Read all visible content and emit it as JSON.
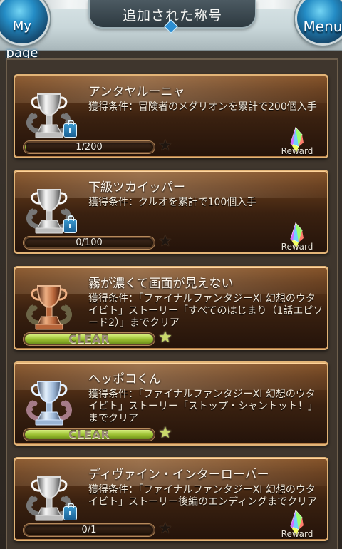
{
  "header": {
    "title": "追加された称号",
    "mypage_label_1": "My",
    "mypage_label_2": "page",
    "menu_label": "Menu"
  },
  "colors": {
    "gold_frame": "#e2b477",
    "card_brown": "#62391a",
    "progress_green": "#99bd2f",
    "blue_lock": "#1a5f93"
  },
  "titles": [
    {
      "name": "アンタヤルーニャ",
      "description": "獲得条件：冒険者のメダリオンを累計で200個入手",
      "progress_text": "1/200",
      "progress_ratio": 0.005,
      "state": "locked",
      "trophy": "silver-trophy",
      "show_reward": true,
      "reward_label": "Reward"
    },
    {
      "name": "下級ツカイッパー",
      "description": "獲得条件：クルオを累計で100個入手",
      "progress_text": "0/100",
      "progress_ratio": 0,
      "state": "locked",
      "trophy": "silver-trophy",
      "show_reward": true,
      "reward_label": "Reward"
    },
    {
      "name": "霧が濃くて画面が見えない",
      "description": "獲得条件：「ファイナルファンタジーXI 幻想のウタイビト」ストーリー「すべてのはじまり（1話エピソード2）」までクリア",
      "progress_text": "CLEAR",
      "progress_ratio": 1,
      "state": "cleared",
      "trophy": "bronze-trophy",
      "show_reward": false,
      "reward_label": ""
    },
    {
      "name": "ヘッポコくん",
      "description": "獲得条件：「ファイナルファンタジーXI 幻想のウタイビト」ストーリー「ストップ・シャントット！」までクリア",
      "progress_text": "CLEAR",
      "progress_ratio": 1,
      "state": "cleared",
      "trophy": "blue-trophy",
      "show_reward": false,
      "reward_label": ""
    },
    {
      "name": "ディヴァイン・インターローパー",
      "description": "獲得条件：「ファイナルファンタジーXI 幻想のウタイビト」ストーリー後編のエンディングまでクリア",
      "progress_text": "0/1",
      "progress_ratio": 0,
      "state": "locked",
      "trophy": "silver-trophy",
      "show_reward": true,
      "reward_label": "Reward"
    }
  ]
}
